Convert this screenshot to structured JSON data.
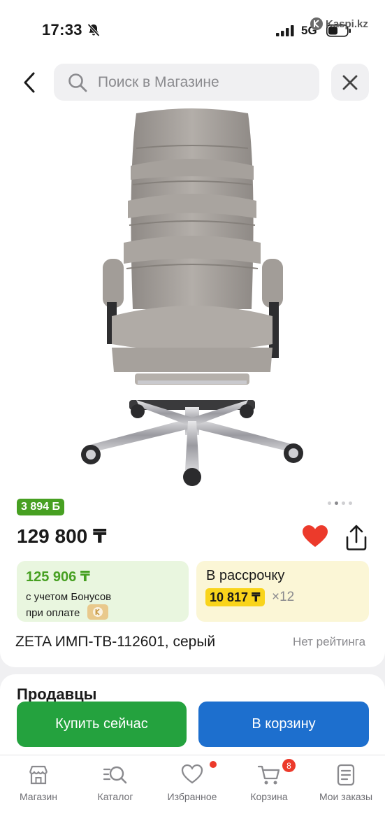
{
  "status_bar": {
    "time": "17:33",
    "network": "5G",
    "watermark": "Kaspi.kz"
  },
  "search": {
    "placeholder": "Поиск в Магазине"
  },
  "product": {
    "bonus_badge": "3 894 Б",
    "price": "129 800 ₸",
    "bonus_price": "125 906 ₸",
    "bonus_line1": "с учетом Бонусов",
    "bonus_line2": "при оплате",
    "installment_label": "В рассрочку",
    "installment_amount": "10 817 ₸",
    "installment_multiplier": "×12",
    "title": "ZETA ИМП-ТВ-112601, серый",
    "rating": "Нет рейтинга",
    "image_count": 4,
    "current_image": 2
  },
  "sellers": {
    "heading": "Продавцы"
  },
  "actions": {
    "buy_now": "Купить сейчас",
    "add_to_cart": "В корзину"
  },
  "bottom_nav": {
    "items": [
      {
        "label": "Магазин",
        "icon": "store-icon"
      },
      {
        "label": "Каталог",
        "icon": "catalog-search-icon"
      },
      {
        "label": "Избранное",
        "icon": "heart-icon"
      },
      {
        "label": "Корзина",
        "icon": "cart-icon"
      },
      {
        "label": "Мои заказы",
        "icon": "orders-icon"
      }
    ],
    "cart_count": "8"
  },
  "colors": {
    "accent_red": "#ec3a2b",
    "bonus_green": "#47a022",
    "buy_green": "#24a23e",
    "cart_blue": "#1d6fce",
    "installment_yellow": "#f9d41b"
  }
}
